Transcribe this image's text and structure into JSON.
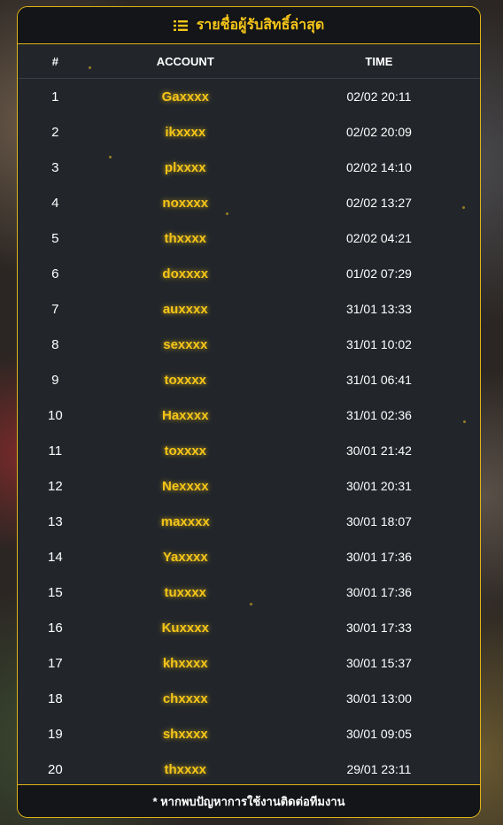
{
  "header": {
    "title": "รายชื่อผู้รับสิทธิ์ล่าสุด",
    "icon": "list-icon"
  },
  "columns": {
    "num": "#",
    "account": "ACCOUNT",
    "time": "TIME"
  },
  "rows": [
    {
      "num": "1",
      "account": "Gaxxxx",
      "time": "02/02 20:11"
    },
    {
      "num": "2",
      "account": "ikxxxx",
      "time": "02/02 20:09"
    },
    {
      "num": "3",
      "account": "plxxxx",
      "time": "02/02 14:10"
    },
    {
      "num": "4",
      "account": "noxxxx",
      "time": "02/02 13:27"
    },
    {
      "num": "5",
      "account": "thxxxx",
      "time": "02/02 04:21"
    },
    {
      "num": "6",
      "account": "doxxxx",
      "time": "01/02 07:29"
    },
    {
      "num": "7",
      "account": "auxxxx",
      "time": "31/01 13:33"
    },
    {
      "num": "8",
      "account": "sexxxx",
      "time": "31/01 10:02"
    },
    {
      "num": "9",
      "account": "toxxxx",
      "time": "31/01 06:41"
    },
    {
      "num": "10",
      "account": "Haxxxx",
      "time": "31/01 02:36"
    },
    {
      "num": "11",
      "account": "toxxxx",
      "time": "30/01 21:42"
    },
    {
      "num": "12",
      "account": "Nexxxx",
      "time": "30/01 20:31"
    },
    {
      "num": "13",
      "account": "maxxxx",
      "time": "30/01 18:07"
    },
    {
      "num": "14",
      "account": "Yaxxxx",
      "time": "30/01 17:36"
    },
    {
      "num": "15",
      "account": "tuxxxx",
      "time": "30/01 17:36"
    },
    {
      "num": "16",
      "account": "Kuxxxx",
      "time": "30/01 17:33"
    },
    {
      "num": "17",
      "account": "khxxxx",
      "time": "30/01 15:37"
    },
    {
      "num": "18",
      "account": "chxxxx",
      "time": "30/01 13:00"
    },
    {
      "num": "19",
      "account": "shxxxx",
      "time": "30/01 09:05"
    },
    {
      "num": "20",
      "account": "thxxxx",
      "time": "29/01 23:11"
    }
  ],
  "footer": {
    "note": "* หากพบปัญหาการใช้งานติดต่อทีมงาน"
  },
  "colors": {
    "accent": "#f5c518",
    "border": "#e0b416",
    "panel": "#22262b",
    "bar": "#141518"
  }
}
